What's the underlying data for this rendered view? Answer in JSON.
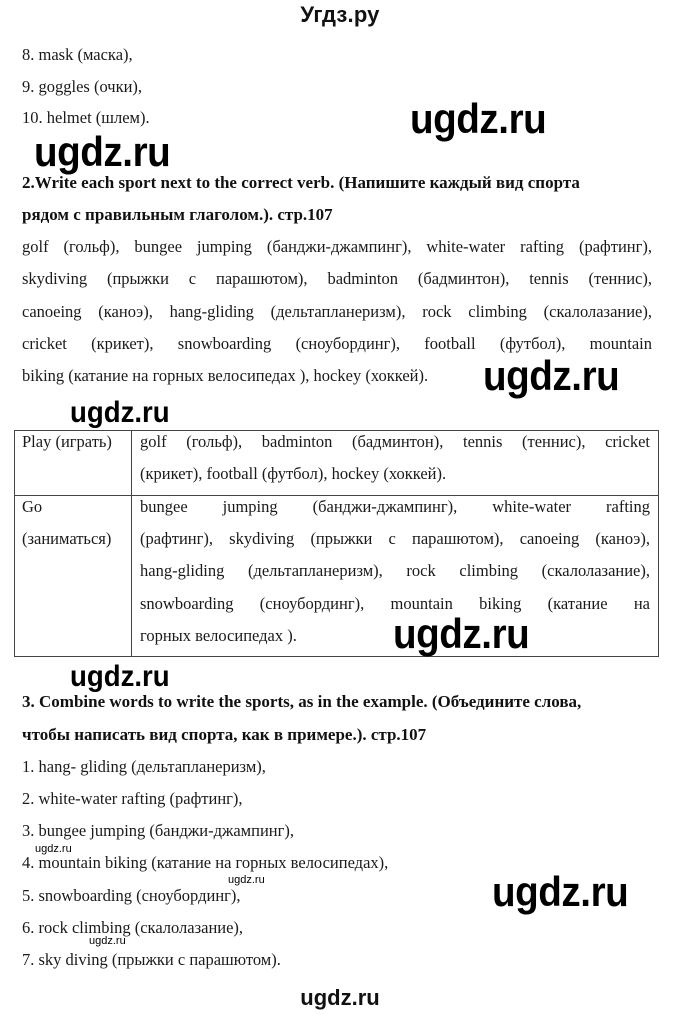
{
  "header": {
    "site_title": "Угдз.ру"
  },
  "previous_list": [
    "8. mask (маска),",
    "9. goggles (очки),",
    "10. helmet (шлем)."
  ],
  "exercise2": {
    "heading_lines": [
      "2.Write each sport next to the correct verb. (Напишите каждый вид спорта",
      "рядом с правильным глаголом.). стр.107"
    ],
    "word_list_lines": [
      "golf (гольф), bungee jumping (банджи-джампинг), white-water rafting (рафтинг),",
      "skydiving (прыжки с парашютом), badminton (бадминтон), tennis (теннис),",
      "canoeing (каноэ), hang-gliding (дельтапланеризм), rock climbing (скалолазание),",
      "cricket (крикет), snowboarding  (сноубординг), football (футбол), mountain",
      "biking (катание на горных велосипедах ), hockey (хоккей)."
    ],
    "table": {
      "rows": [
        {
          "verb_lines": [
            "Play (играть)"
          ],
          "sports_lines": [
            "golf (гольф), badminton (бадминтон), tennis (теннис), cricket",
            "(крикет), football (футбол), hockey (хоккей)."
          ]
        },
        {
          "verb_lines": [
            "Go",
            "(заниматься)"
          ],
          "sports_lines": [
            "bungee jumping (банджи-джампинг), white-water rafting",
            "(рафтинг), skydiving (прыжки с парашютом), canoeing (каноэ),",
            "hang-gliding (дельтапланеризм), rock climbing (скалолазание),",
            "snowboarding  (сноубординг), mountain biking (катание на",
            "горных велосипедах )."
          ]
        }
      ]
    }
  },
  "exercise3": {
    "heading_lines": [
      "3. Combine words to write the sports, as in the example. (Объедините слова,",
      "чтобы написать вид спорта, как в примере.). стр.107"
    ],
    "answers": [
      "1. hang- gliding (дельтапланеризм),",
      "2. white-water rafting (рафтинг),",
      "3. bungee jumping (банджи-джампинг),",
      "4. mountain biking (катание на горных велосипедах),",
      "5. snowboarding (сноубординг),",
      "6. rock climbing (скалолазание),",
      "7. sky diving (прыжки с парашютом)."
    ]
  },
  "watermarks": {
    "text": "ugdz.ru"
  },
  "footer": {
    "site_watermark": "ugdz.ru"
  }
}
